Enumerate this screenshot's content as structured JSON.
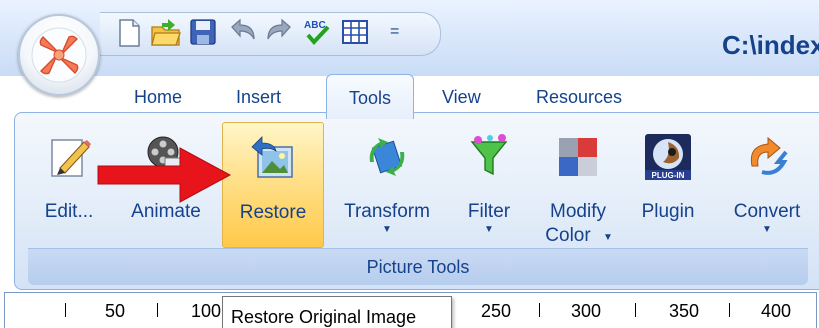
{
  "window": {
    "title": "C:\\index"
  },
  "quick_access": {
    "items": [
      "new-file-icon",
      "open-folder-icon",
      "save-icon",
      "undo-icon",
      "redo-icon",
      "spellcheck-icon",
      "table-icon"
    ],
    "more": "="
  },
  "tabs": [
    "Home",
    "Insert",
    "Tools",
    "View",
    "Resources"
  ],
  "active_tab": "Tools",
  "ribbon": {
    "group_label": "Picture Tools",
    "buttons": [
      {
        "label": "Edit...",
        "icon": "edit-pencil-icon",
        "dropdown": false
      },
      {
        "label": "Animate",
        "icon": "film-reel-icon",
        "dropdown": false
      },
      {
        "label": "Restore",
        "icon": "restore-image-icon",
        "dropdown": false,
        "highlighted": true
      },
      {
        "label": "Transform",
        "icon": "transform-icon",
        "dropdown": true
      },
      {
        "label": "Filter",
        "icon": "filter-funnel-icon",
        "dropdown": true
      },
      {
        "label": "Modify",
        "label2": "Color",
        "icon": "color-blocks-icon",
        "dropdown": true
      },
      {
        "label": "Plugin",
        "icon": "plugin-icon",
        "badge": "PLUG-IN",
        "dropdown": false
      },
      {
        "label": "Convert",
        "icon": "convert-arrow-icon",
        "dropdown": true
      }
    ]
  },
  "ruler": {
    "labels": [
      "50",
      "100",
      "250",
      "300",
      "350",
      "400"
    ]
  },
  "tooltip": {
    "text": "Restore Original Image"
  },
  "colors": {
    "accent_text": "#15428b",
    "highlight": "#ffd46a",
    "pointer_arrow": "#e8141b"
  }
}
